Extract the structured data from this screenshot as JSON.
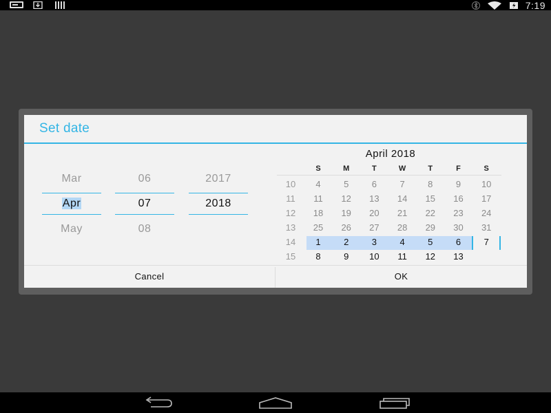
{
  "status_bar": {
    "time": "7:19",
    "notification_icons": [
      "screenshot-icon",
      "download-icon",
      "barcode-icon"
    ],
    "status_icons": [
      "bluetooth-icon",
      "wifi-icon",
      "battery-charging-icon"
    ]
  },
  "dialog": {
    "title": "Set date",
    "accent_color": "#33b5e5",
    "spinners": {
      "month": {
        "prev": "Mar",
        "current": "Apr",
        "next": "May"
      },
      "day": {
        "prev": "06",
        "current": "07",
        "next": "08"
      },
      "year": {
        "prev": "2017",
        "current": "2018",
        "next": ""
      }
    },
    "calendar": {
      "title": "April 2018",
      "weekday_headers": [
        "S",
        "M",
        "T",
        "W",
        "T",
        "F",
        "S"
      ],
      "weeks": [
        {
          "week": "10",
          "days": [
            "4",
            "5",
            "6",
            "7",
            "8",
            "9",
            "10"
          ]
        },
        {
          "week": "11",
          "days": [
            "11",
            "12",
            "13",
            "14",
            "15",
            "16",
            "17"
          ]
        },
        {
          "week": "12",
          "days": [
            "18",
            "19",
            "20",
            "21",
            "22",
            "23",
            "24"
          ]
        },
        {
          "week": "13",
          "days": [
            "25",
            "26",
            "27",
            "28",
            "29",
            "30",
            "31"
          ]
        },
        {
          "week": "14",
          "days": [
            "1",
            "2",
            "3",
            "4",
            "5",
            "6",
            "7"
          ]
        },
        {
          "week": "15",
          "days": [
            "8",
            "9",
            "10",
            "11",
            "12",
            "13",
            ""
          ]
        }
      ],
      "selected_day": "7"
    },
    "buttons": {
      "cancel": "Cancel",
      "ok": "OK"
    }
  },
  "nav_bar": {
    "icons": [
      "back-icon",
      "home-icon",
      "recent-apps-icon"
    ]
  }
}
